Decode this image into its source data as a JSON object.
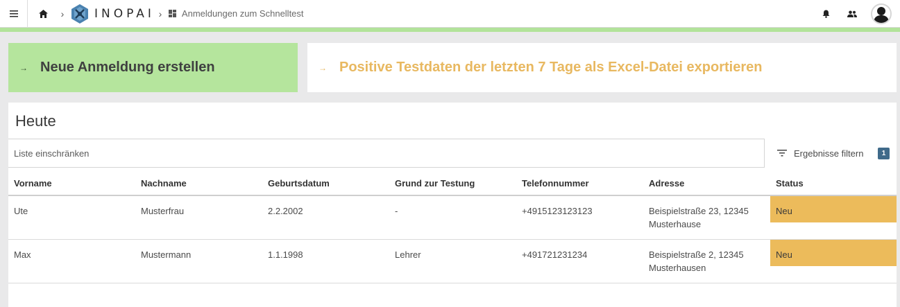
{
  "topbar": {
    "menu_icon": "hamburger-menu-icon",
    "home_icon": "home-icon",
    "logo_text": "INOPAI",
    "breadcrumb_icon": "dashboard-grid-icon",
    "breadcrumb_label": "Anmeldungen zum Schnelltest",
    "notification_icon": "bell-icon",
    "people_icon": "people-icon",
    "avatar_icon": "user-avatar-icon"
  },
  "actions": {
    "new_label": "Neue Anmeldung erstellen",
    "export_label": "Positive Testdaten der letzten 7 Tage als Excel-Datei exportieren"
  },
  "panel": {
    "title": "Heute",
    "filter_placeholder": "Liste einschränken",
    "filter_button_label": "Ergebnisse filtern",
    "filter_count": "1"
  },
  "table": {
    "columns": [
      "Vorname",
      "Nachname",
      "Geburtsdatum",
      "Grund zur Testung",
      "Telefonnummer",
      "Adresse",
      "Status"
    ],
    "rows": [
      {
        "vorname": "Ute",
        "nachname": "Musterfrau",
        "geburtsdatum": "2.2.2002",
        "grund": "-",
        "telefon": "+4915123123123",
        "adresse_line1": "Beispielstraße 23, 12345",
        "adresse_line2": "Musterhause",
        "status": "Neu"
      },
      {
        "vorname": "Max",
        "nachname": "Mustermann",
        "geburtsdatum": "1.1.1998",
        "grund": "Lehrer",
        "telefon": "+491721231234",
        "adresse_line1": "Beispielstraße 2, 12345",
        "adresse_line2": "Musterhausen",
        "status": "Neu"
      }
    ]
  },
  "colors": {
    "accent_green": "#b5e59d",
    "accent_orange": "#e8b860",
    "status_new": "#ecbb5b",
    "badge": "#3f6a8a"
  }
}
